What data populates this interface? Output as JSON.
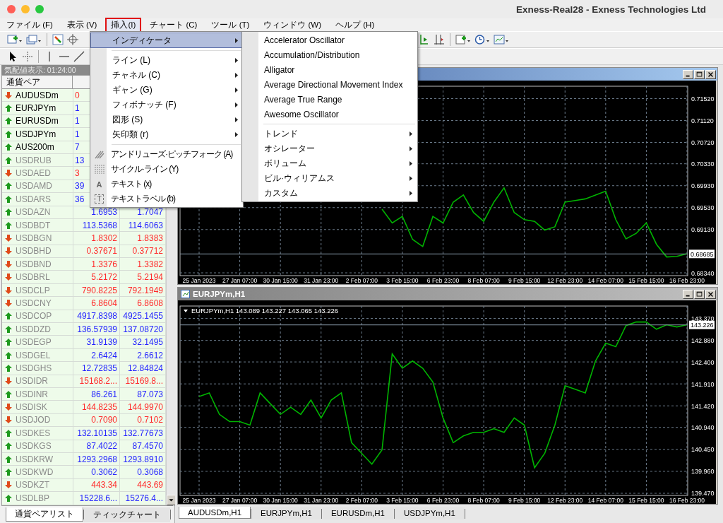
{
  "window": {
    "title": "Exness-Real28 - Exness Technologies Ltd"
  },
  "menu_bar": [
    {
      "label": "ファイル (F)",
      "selected": false
    },
    {
      "label": "表示 (V)",
      "selected": false
    },
    {
      "label": "挿入(I)",
      "selected": true
    },
    {
      "label": "チャート (C)",
      "selected": false
    },
    {
      "label": "ツール (T)",
      "selected": false
    },
    {
      "label": "ウィンドウ (W)",
      "selected": false
    },
    {
      "label": "ヘルプ (H)",
      "selected": false
    }
  ],
  "insert_menu": {
    "items": [
      {
        "kind": "item",
        "label": "インディケータ",
        "submenu": true,
        "selected": true
      },
      {
        "kind": "separator"
      },
      {
        "kind": "item",
        "label": "ライン (L)",
        "submenu": true,
        "selected": false
      },
      {
        "kind": "item",
        "label": "チャネル (C)",
        "submenu": true,
        "selected": false
      },
      {
        "kind": "item",
        "label": "ギャン (G)",
        "submenu": true,
        "selected": false
      },
      {
        "kind": "item",
        "label": "フィボナッチ (F)",
        "submenu": true,
        "selected": false
      },
      {
        "kind": "item",
        "label": "図形 (S)",
        "submenu": true,
        "selected": false
      },
      {
        "kind": "item",
        "label": "矢印類 (r)",
        "submenu": true,
        "selected": false
      },
      {
        "kind": "separator"
      },
      {
        "kind": "tool",
        "label": "アンドリューズ·ピッチフォーク (A)",
        "submenu": false,
        "selected": false
      },
      {
        "kind": "tool",
        "label": "サイクル·ライン (Y)",
        "submenu": false,
        "selected": false
      },
      {
        "kind": "tool",
        "label": "テキスト (x)",
        "submenu": false,
        "selected": false,
        "glyph": "A"
      },
      {
        "kind": "tool",
        "label": "テキストラベル (b)",
        "submenu": false,
        "selected": false,
        "glyph": "T"
      }
    ]
  },
  "indicator_submenu": {
    "items": [
      {
        "kind": "item",
        "label": "Accelerator Oscillator",
        "submenu": false,
        "selected": false
      },
      {
        "kind": "item",
        "label": "Accumulation/Distribution",
        "submenu": false,
        "selected": false
      },
      {
        "kind": "item",
        "label": "Alligator",
        "submenu": false,
        "selected": false
      },
      {
        "kind": "item",
        "label": "Average Directional Movement Index",
        "submenu": false,
        "selected": false
      },
      {
        "kind": "item",
        "label": "Average True Range",
        "submenu": false,
        "selected": false
      },
      {
        "kind": "item",
        "label": "Awesome Oscillator",
        "submenu": false,
        "selected": false
      },
      {
        "kind": "separator"
      },
      {
        "kind": "item",
        "label": "トレンド",
        "submenu": true,
        "selected": false
      },
      {
        "kind": "item",
        "label": "オシレーター",
        "submenu": true,
        "selected": false
      },
      {
        "kind": "item",
        "label": "ボリューム",
        "submenu": true,
        "selected": false
      },
      {
        "kind": "item",
        "label": "ビル·ウィリアムス",
        "submenu": true,
        "selected": false
      },
      {
        "kind": "item",
        "label": "カスタム",
        "submenu": true,
        "selected": false
      }
    ]
  },
  "market_watch": {
    "title": "気配値表示: 01:24:00",
    "columns": [
      "通貨ペア"
    ],
    "rows": [
      {
        "symbol": "AUDUSDm",
        "kind": "down",
        "dimmed": false,
        "bid": "0"
      },
      {
        "symbol": "EURJPYm",
        "kind": "up",
        "dimmed": false,
        "bid": "1"
      },
      {
        "symbol": "EURUSDm",
        "kind": "up",
        "dimmed": false,
        "bid": "1"
      },
      {
        "symbol": "USDJPYm",
        "kind": "up",
        "dimmed": false,
        "bid": "1"
      },
      {
        "symbol": "AUS200m",
        "kind": "up",
        "dimmed": false,
        "bid": "7"
      },
      {
        "symbol": "USDRUB",
        "kind": "up",
        "dimmed": true,
        "bid": "13"
      },
      {
        "symbol": "USDAED",
        "kind": "down",
        "dimmed": true,
        "bid": "3"
      },
      {
        "symbol": "USDAMD",
        "kind": "up",
        "dimmed": true,
        "bid": "39"
      },
      {
        "symbol": "USDARS",
        "kind": "up",
        "dimmed": true,
        "bid": "36"
      },
      {
        "symbol": "USDAZN",
        "kind": "up",
        "dimmed": true,
        "bid": "1.6953",
        "ask": "1.7047"
      },
      {
        "symbol": "USDBDT",
        "kind": "up",
        "dimmed": true,
        "bid": "113.5368",
        "ask": "114.6063"
      },
      {
        "symbol": "USDBGN",
        "kind": "down",
        "dimmed": true,
        "bid": "1.8302",
        "ask": "1.8383"
      },
      {
        "symbol": "USDBHD",
        "kind": "down",
        "dimmed": true,
        "bid": "0.37671",
        "ask": "0.37712"
      },
      {
        "symbol": "USDBND",
        "kind": "down",
        "dimmed": true,
        "bid": "1.3376",
        "ask": "1.3382"
      },
      {
        "symbol": "USDBRL",
        "kind": "down",
        "dimmed": true,
        "bid": "5.2172",
        "ask": "5.2194"
      },
      {
        "symbol": "USDCLP",
        "kind": "down",
        "dimmed": true,
        "bid": "790.8225",
        "ask": "792.1949"
      },
      {
        "symbol": "USDCNY",
        "kind": "down",
        "dimmed": true,
        "bid": "6.8604",
        "ask": "6.8608"
      },
      {
        "symbol": "USDCOP",
        "kind": "up",
        "dimmed": true,
        "bid": "4917.8398",
        "ask": "4925.1455"
      },
      {
        "symbol": "USDDZD",
        "kind": "up",
        "dimmed": true,
        "bid": "136.57939",
        "ask": "137.08720"
      },
      {
        "symbol": "USDEGP",
        "kind": "up",
        "dimmed": true,
        "bid": "31.9139",
        "ask": "32.1495"
      },
      {
        "symbol": "USDGEL",
        "kind": "up",
        "dimmed": true,
        "bid": "2.6424",
        "ask": "2.6612"
      },
      {
        "symbol": "USDGHS",
        "kind": "up",
        "dimmed": true,
        "bid": "12.72835",
        "ask": "12.84824"
      },
      {
        "symbol": "USDIDR",
        "kind": "down",
        "dimmed": true,
        "bid": "15168.2...",
        "ask": "15169.8..."
      },
      {
        "symbol": "USDINR",
        "kind": "up",
        "dimmed": true,
        "bid": "86.261",
        "ask": "87.073"
      },
      {
        "symbol": "USDISK",
        "kind": "down",
        "dimmed": true,
        "bid": "144.8235",
        "ask": "144.9970"
      },
      {
        "symbol": "USDJOD",
        "kind": "down",
        "dimmed": true,
        "bid": "0.7090",
        "ask": "0.7102"
      },
      {
        "symbol": "USDKES",
        "kind": "up",
        "dimmed": true,
        "bid": "132.10135",
        "ask": "132.77673"
      },
      {
        "symbol": "USDKGS",
        "kind": "up",
        "dimmed": true,
        "bid": "87.4022",
        "ask": "87.4570"
      },
      {
        "symbol": "USDKRW",
        "kind": "up",
        "dimmed": true,
        "bid": "1293.2968",
        "ask": "1293.8910"
      },
      {
        "symbol": "USDKWD",
        "kind": "up",
        "dimmed": true,
        "bid": "0.3062",
        "ask": "0.3068"
      },
      {
        "symbol": "USDKZT",
        "kind": "down",
        "dimmed": true,
        "bid": "443.34",
        "ask": "443.69"
      },
      {
        "symbol": "USDLBP",
        "kind": "up",
        "dimmed": true,
        "bid": "15228.6...",
        "ask": "15276.4..."
      }
    ],
    "tabs": [
      {
        "label": "通貨ペアリスト",
        "selected": true
      },
      {
        "label": "ティックチャート",
        "selected": false
      }
    ]
  },
  "charts": [
    {
      "active": true,
      "chart_data": {
        "type": "line",
        "grid": true,
        "ylim": [
          0.68289,
          0.71745
        ],
        "categories": [
          "25 Jan 2023",
          null,
          null,
          null,
          "27 Jan 07:00",
          null,
          null,
          null,
          "30 Jan 15:00",
          null,
          null,
          null,
          "31 Jan 23:00",
          null,
          null,
          null,
          "2 Feb 07:00",
          null,
          null,
          null,
          "3 Feb 15:00",
          null,
          null,
          null,
          "6 Feb 23:00",
          null,
          null,
          null,
          "8 Feb 07:00",
          null,
          null,
          null,
          "9 Feb 15:00",
          null,
          null,
          null,
          "12 Feb 23:00",
          null,
          null,
          null,
          "14 Feb 07:00",
          null,
          null,
          null,
          "15 Feb 15:00",
          null,
          null,
          null,
          "16 Feb 23:00"
        ],
        "yticks": [
          {
            "value": 0.7152,
            "label": "0.71520"
          },
          {
            "value": 0.7112,
            "label": "0.71120"
          },
          {
            "value": 0.7072,
            "label": "0.70720"
          },
          {
            "value": 0.7033,
            "label": "0.70330"
          },
          {
            "value": 0.6993,
            "label": "0.69930"
          },
          {
            "value": 0.6953,
            "label": "0.69530"
          },
          {
            "value": 0.6913,
            "label": "0.69130"
          },
          {
            "value": 0.6834,
            "label": "0.68340"
          }
        ],
        "series": [
          {
            "color": "#00b400",
            "values": [
              null,
              null,
              null,
              null,
              null,
              null,
              null,
              null,
              null,
              null,
              null,
              null,
              null,
              null,
              null,
              null,
              null,
              null,
              0.695,
              0.6925,
              0.6937,
              0.6895,
              0.6882,
              0.6937,
              0.6925,
              0.6963,
              0.6976,
              0.6944,
              0.6928,
              0.6963,
              0.6989,
              0.6944,
              0.6931,
              0.6928,
              0.6912,
              0.6918,
              0.6963,
              0.6966,
              0.6969,
              0.6976,
              0.6983,
              0.6931,
              0.6896,
              0.6906,
              0.6925,
              0.6886,
              0.6863,
              0.6864,
              0.6869
            ]
          }
        ],
        "ref_lines": [
          {
            "axis": "y",
            "value": 0.68685,
            "label": "0.68685",
            "color": "#8898a8"
          }
        ]
      }
    },
    {
      "active": false,
      "title": "EURJPYm,H1",
      "info": "EURJPYm,H1 143.089 143.227 143.065 143.226",
      "chart_data": {
        "type": "line",
        "grid": true,
        "ylim": [
          139.422,
          143.647
        ],
        "categories": [
          "25 Jan 2023",
          null,
          null,
          null,
          "27 Jan 07:00",
          null,
          null,
          null,
          "30 Jan 15:00",
          null,
          null,
          null,
          "31 Jan 23:00",
          null,
          null,
          null,
          "2 Feb 07:00",
          null,
          null,
          null,
          "3 Feb 15:00",
          null,
          null,
          null,
          "6 Feb 23:00",
          null,
          null,
          null,
          "8 Feb 07:00",
          null,
          null,
          null,
          "9 Feb 15:00",
          null,
          null,
          null,
          "12 Feb 23:00",
          null,
          null,
          null,
          "14 Feb 07:00",
          null,
          null,
          null,
          "15 Feb 15:00",
          null,
          null,
          null,
          "16 Feb 23:00"
        ],
        "yticks": [
          {
            "value": 143.37,
            "label": "143.370"
          },
          {
            "value": 142.88,
            "label": "142.880"
          },
          {
            "value": 142.4,
            "label": "142.400"
          },
          {
            "value": 141.91,
            "label": "141.910"
          },
          {
            "value": 141.42,
            "label": "141.420"
          },
          {
            "value": 140.94,
            "label": "140.940"
          },
          {
            "value": 140.45,
            "label": "140.450"
          },
          {
            "value": 139.96,
            "label": "139.960"
          },
          {
            "value": 139.47,
            "label": "139.470"
          }
        ],
        "series": [
          {
            "color": "#00b400",
            "values": [
              141.63,
              141.71,
              141.23,
              141.07,
              141.07,
              140.99,
              141.71,
              141.47,
              141.23,
              141.39,
              141.23,
              141.55,
              141.15,
              141.55,
              141.71,
              140.6,
              140.36,
              140.12,
              140.44,
              142.58,
              142.26,
              142.42,
              142.26,
              141.95,
              141.15,
              140.6,
              140.75,
              140.83,
              140.83,
              140.91,
              140.83,
              141.15,
              140.99,
              140.04,
              140.36,
              140.99,
              141.87,
              141.79,
              141.71,
              142.42,
              142.82,
              142.74,
              143.21,
              143.29,
              143.29,
              143.13,
              143.23,
              143.18,
              143.23
            ]
          }
        ],
        "ref_lines": [
          {
            "axis": "y",
            "value": 143.226,
            "label": "143.226",
            "color": "#8898a8"
          }
        ]
      }
    }
  ],
  "chart_tabs": [
    {
      "label": "AUDUSDm,H1",
      "selected": true
    },
    {
      "label": "EURJPYm,H1",
      "selected": false
    },
    {
      "label": "EURUSDm,H1",
      "selected": false
    },
    {
      "label": "USDJPYm,H1",
      "selected": false
    }
  ]
}
